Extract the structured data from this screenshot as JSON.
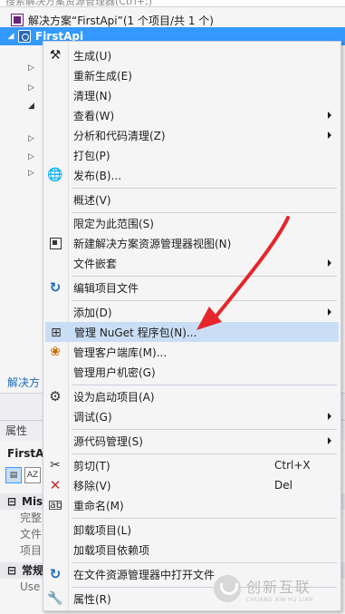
{
  "solution_explorer": {
    "search_placeholder": "搜索解决方案资源管理器(Ctrl+;)",
    "solution_label": "解决方案“FirstApi”(1 个项目/共 1 个)",
    "project_label": "FirstApi",
    "bottom_link": "解决方"
  },
  "properties": {
    "title": "属性",
    "object": "FirstA",
    "categories": [
      {
        "label": "Mis",
        "rows": [
          "完整",
          "文件",
          "项目"
        ]
      },
      {
        "label": "常规",
        "rows": [
          "Use"
        ]
      }
    ]
  },
  "context_menu": {
    "items": [
      {
        "label": "生成(U)",
        "icon": "build-icon"
      },
      {
        "label": "重新生成(E)"
      },
      {
        "label": "清理(N)"
      },
      {
        "label": "查看(W)",
        "submenu": true
      },
      {
        "label": "分析和代码清理(Z)",
        "submenu": true
      },
      {
        "label": "打包(P)"
      },
      {
        "label": "发布(B)...",
        "icon": "globe-icon"
      },
      {
        "label": "概述(V)"
      },
      {
        "label": "限定为此范围(S)"
      },
      {
        "label": "新建解决方案资源管理器视图(N)",
        "icon": "new-view-icon"
      },
      {
        "label": "文件嵌套",
        "submenu": true
      },
      {
        "label": "编辑项目文件",
        "icon": "refresh-icon"
      },
      {
        "label": "添加(D)",
        "submenu": true
      },
      {
        "label": "管理 NuGet 程序包(N)...",
        "icon": "nuget-icon",
        "highlighted": true
      },
      {
        "label": "管理客户端库(M)...",
        "icon": "client-library-icon"
      },
      {
        "label": "管理用户机密(G)"
      },
      {
        "label": "设为启动项目(A)",
        "icon": "gear-icon"
      },
      {
        "label": "调试(G)",
        "submenu": true
      },
      {
        "label": "源代码管理(S)",
        "submenu": true
      },
      {
        "label": "剪切(T)",
        "shortcut": "Ctrl+X",
        "icon": "scissors-icon"
      },
      {
        "label": "移除(V)",
        "shortcut": "Del",
        "icon": "remove-icon"
      },
      {
        "label": "重命名(M)",
        "icon": "rename-icon"
      },
      {
        "label": "卸载项目(L)"
      },
      {
        "label": "加载项目依赖项"
      },
      {
        "label": "在文件资源管理器中打开文件",
        "icon": "refresh-icon"
      },
      {
        "label": "属性(R)",
        "icon": "wrench-icon"
      }
    ]
  },
  "watermark": {
    "text": "创新互联",
    "subtext": "CHUANG XIN HU LIAN"
  },
  "colors": {
    "selection": "#3399ff",
    "menu_hover": "#c9def5",
    "annotation_arrow": "#e5262b"
  }
}
